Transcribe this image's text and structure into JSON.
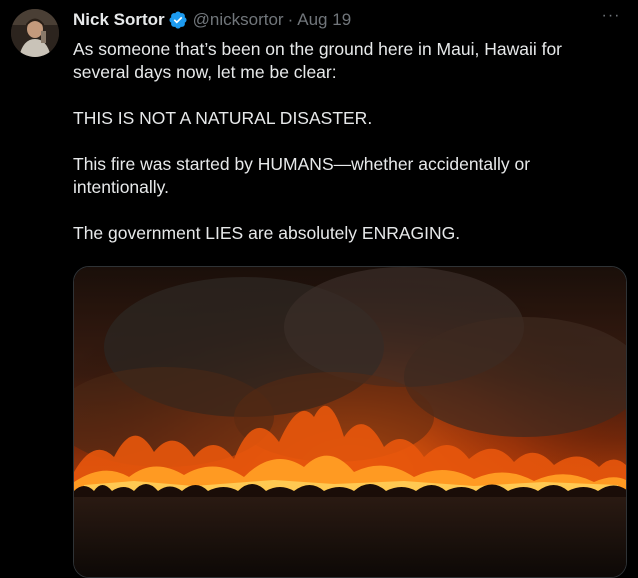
{
  "user": {
    "display_name": "Nick Sortor",
    "handle": "@nicksortor",
    "separator": "·",
    "date": "Aug 19",
    "verified": true
  },
  "more_button": {
    "glyph": "···"
  },
  "tweet": {
    "paragraphs": [
      "As someone that’s been on the ground here in Maui, Hawaii for several days now, let me be clear:",
      "THIS IS NOT A NATURAL DISASTER.",
      "This fire was started by HUMANS—whether accidentally or intentionally.",
      "The government LIES are absolutely ENRAGING."
    ]
  },
  "media": {
    "type": "image",
    "icon": "wildfire-photo"
  },
  "colors": {
    "background": "#000000",
    "text_primary": "#e7e9ea",
    "text_secondary": "#71767b",
    "verified_blue": "#1d9bf0"
  }
}
